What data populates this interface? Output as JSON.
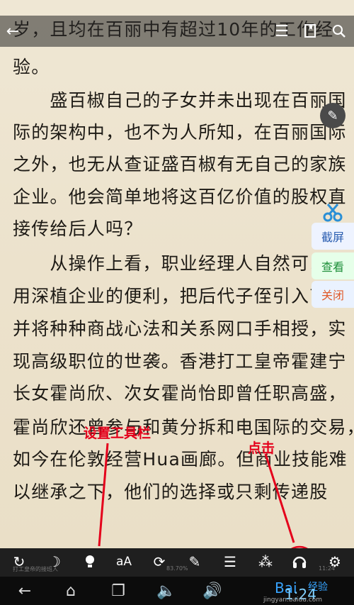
{
  "reader": {
    "lines": [
      "岁，且均在百丽中有超过10年的工作经",
      "验。",
      "　　盛百椒自己的子女并未出现在百丽国",
      "际的架构中，也不为人所知，在百丽国际",
      "之外，也无从查证盛百椒有无自己的家族",
      "企业。他会简单地将这百亿价值的股权直",
      "接传给后人吗？",
      "　　从操作上看，职业经理人自然可以享",
      "用深植企业的便利，把后代子侄引入商界，",
      "并将种种商战心法和关系网口手相授，实",
      "现高级职位的世袭。香港打工皇帝霍建宁",
      "长女霍尚欣、次女霍尚怡即曾任职高盛，",
      "霍尚欣还曾参与和黄分拆和电国际的交易，",
      "如今在伦敦经营Hua画廊。但商业技能难",
      "以继承之下，他们的选择或只剩传递股"
    ]
  },
  "side_panel": {
    "screenshot": "截屏",
    "view": "查看",
    "close": "关闭"
  },
  "annotations": {
    "toolbar_label": "设置工具栏",
    "click_label": "点击"
  },
  "status": {
    "book": "打工皇帝的接班人",
    "progress": "83.70%",
    "time": "11:24"
  },
  "navbar": {
    "clock": "1:24",
    "watermark": "jingyan.baidu.com",
    "watermark_brand": "Bai",
    "watermark_brand2": "经验"
  },
  "colors": {
    "screenshot_bg": "#eef3ff",
    "view_bg": "#e6ffe9",
    "close_bg": "#eaf2ff",
    "annotation": "#e4001b"
  }
}
